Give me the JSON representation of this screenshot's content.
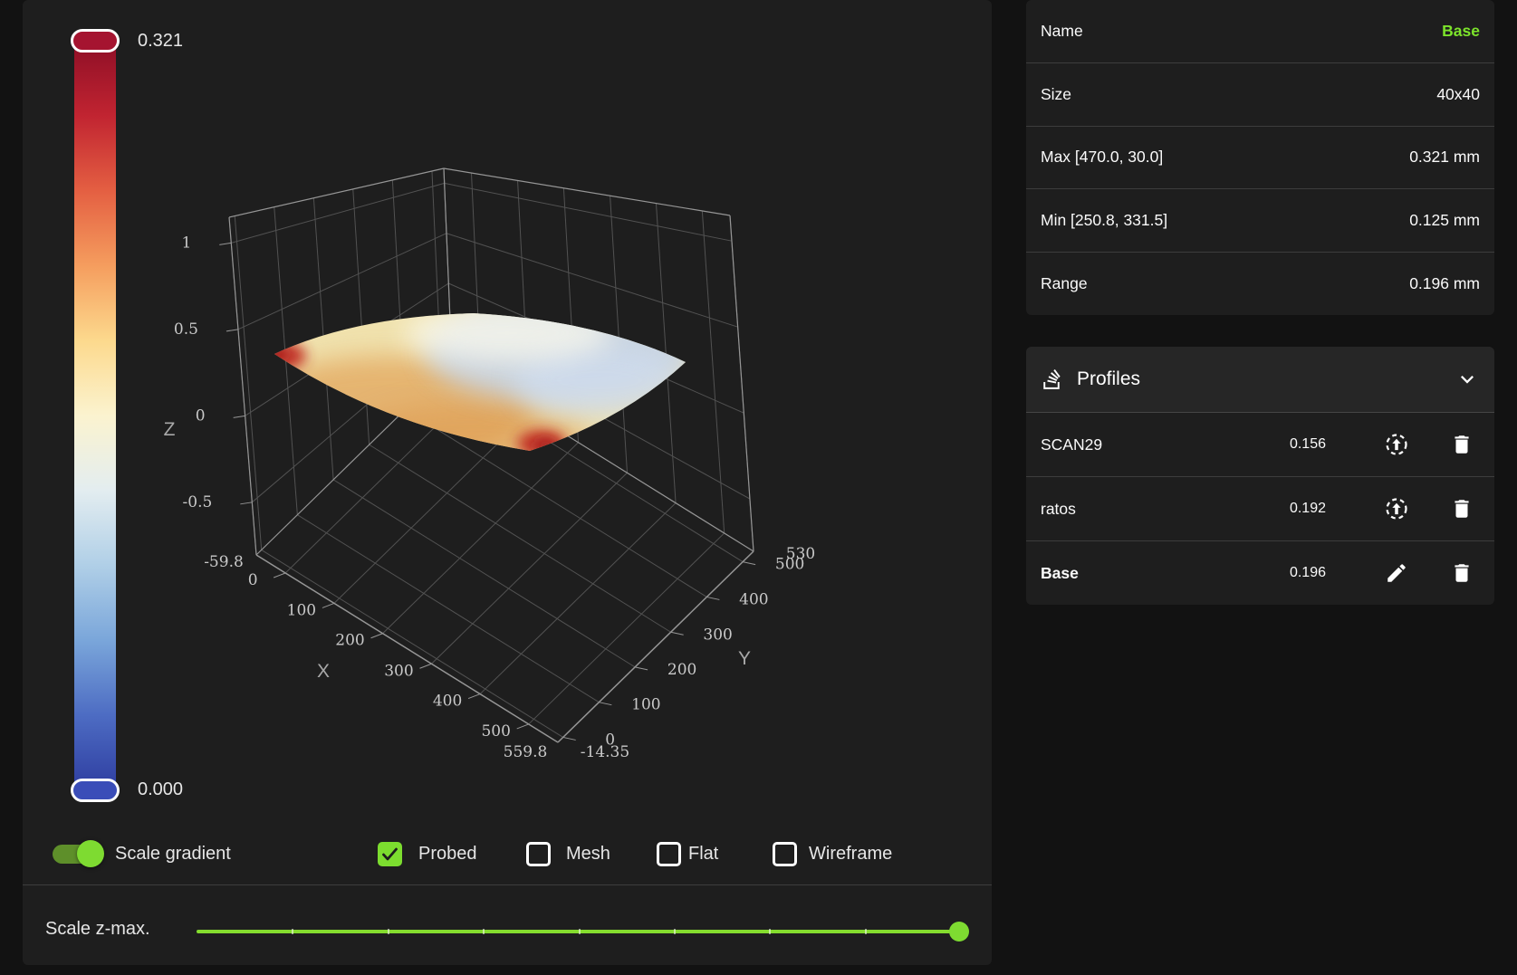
{
  "colors": {
    "page_bg": "#121212",
    "card_bg": "#1e1e1e",
    "accent": "#7cdd2f",
    "accent_text": "#7ce32b",
    "toggle_track": "#5e8f2a",
    "handle_top": "#a51430",
    "handle_bottom": "#3a4db8",
    "grid": "#525252",
    "edge": "#969696"
  },
  "colorbar": {
    "max_label": "0.321",
    "min_label": "0.000",
    "stops": [
      "#8d0e26",
      "#c12431",
      "#e45f42",
      "#f59d5e",
      "#fcd98d",
      "#fbf3cf",
      "#e3edf0",
      "#b0cfe7",
      "#7aa6da",
      "#4d6cc3",
      "#2e3da0"
    ]
  },
  "plot": {
    "x_axis": {
      "title": "X",
      "tick_labels": [
        "0",
        "100",
        "200",
        "300",
        "400",
        "500"
      ],
      "edge_min_label": "-59.8",
      "edge_max_label": "559.8"
    },
    "y_axis": {
      "title": "Y",
      "tick_labels": [
        "0",
        "100",
        "200",
        "300",
        "400",
        "500"
      ],
      "edge_min_label": "-14.35",
      "edge_max_label": "530"
    },
    "z_axis": {
      "title": "Z",
      "tick_labels": [
        "1",
        "0.5",
        "0",
        "-0.5"
      ]
    }
  },
  "controls": {
    "scale_gradient": {
      "label": "Scale gradient",
      "on": true
    },
    "view_modes": [
      {
        "label": "Probed",
        "checked": true
      },
      {
        "label": "Mesh",
        "checked": false
      },
      {
        "label": "Flat",
        "checked": false
      },
      {
        "label": "Wireframe",
        "checked": false
      }
    ],
    "scale_z": {
      "label": "Scale z-max.",
      "value_fraction": 1
    }
  },
  "info_table": {
    "rows": [
      {
        "label": "Name",
        "value": "Base",
        "accent": true
      },
      {
        "label": "Size",
        "value": "40x40",
        "accent": false
      },
      {
        "label": "Max [470.0, 30.0]",
        "value": "0.321 mm",
        "accent": false
      },
      {
        "label": "Min [250.8, 331.5]",
        "value": "0.125 mm",
        "accent": false
      },
      {
        "label": "Range",
        "value": "0.196 mm",
        "accent": false
      }
    ]
  },
  "profiles": {
    "title": "Profiles",
    "rows": [
      {
        "name": "SCAN29",
        "value": "0.156",
        "action": "load",
        "active": false
      },
      {
        "name": "ratos",
        "value": "0.192",
        "action": "load",
        "active": false
      },
      {
        "name": "Base",
        "value": "0.196",
        "action": "edit",
        "active": true
      }
    ]
  },
  "chart_data": {
    "type": "surface-heightmap",
    "x_range": [
      -59.8,
      559.8
    ],
    "y_range": [
      -14.35,
      530
    ],
    "x_ticks": [
      0,
      100,
      200,
      300,
      400,
      500
    ],
    "y_ticks": [
      0,
      100,
      200,
      300,
      400,
      500
    ],
    "z_ticks": [
      -0.5,
      0,
      0.5,
      1
    ],
    "mesh_size": "40x40",
    "max_point": {
      "x": 470.0,
      "y": 30.0,
      "z_mm": 0.321
    },
    "min_point": {
      "x": 250.8,
      "y": 331.5,
      "z_mm": 0.125
    },
    "range_mm": 0.196,
    "colorbar_max": 0.321,
    "colorbar_min": 0.0
  }
}
